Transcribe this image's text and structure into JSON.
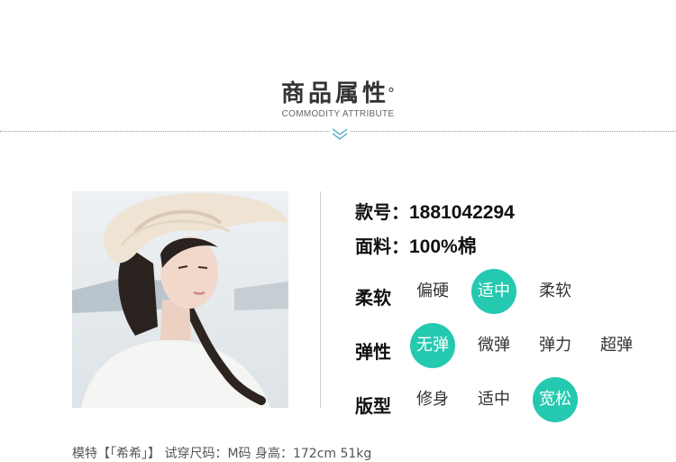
{
  "heading": {
    "title": "商品属性",
    "degree_mark": "°",
    "subtitle": "COMMODITY ATTRIBUTE"
  },
  "product": {
    "style_no_label": "款号：",
    "style_no": "1881042294",
    "fabric_label": "面料：",
    "fabric": "100%棉"
  },
  "attributes": [
    {
      "label": "柔软",
      "options": [
        "偏硬",
        "适中",
        "柔软"
      ],
      "selected": "适中"
    },
    {
      "label": "弹性",
      "options": [
        "无弹",
        "微弹",
        "弹力",
        "超弹"
      ],
      "selected": "无弹"
    },
    {
      "label": "版型",
      "options": [
        "修身",
        "适中",
        "宽松"
      ],
      "selected": "宽松"
    }
  ],
  "footer": {
    "model_info": "模特【「希希」】 试穿尺码：M码 身高：172cm 51kg"
  },
  "colors": {
    "accent": "#25c9b0",
    "chevron": "#5fb3c6"
  }
}
